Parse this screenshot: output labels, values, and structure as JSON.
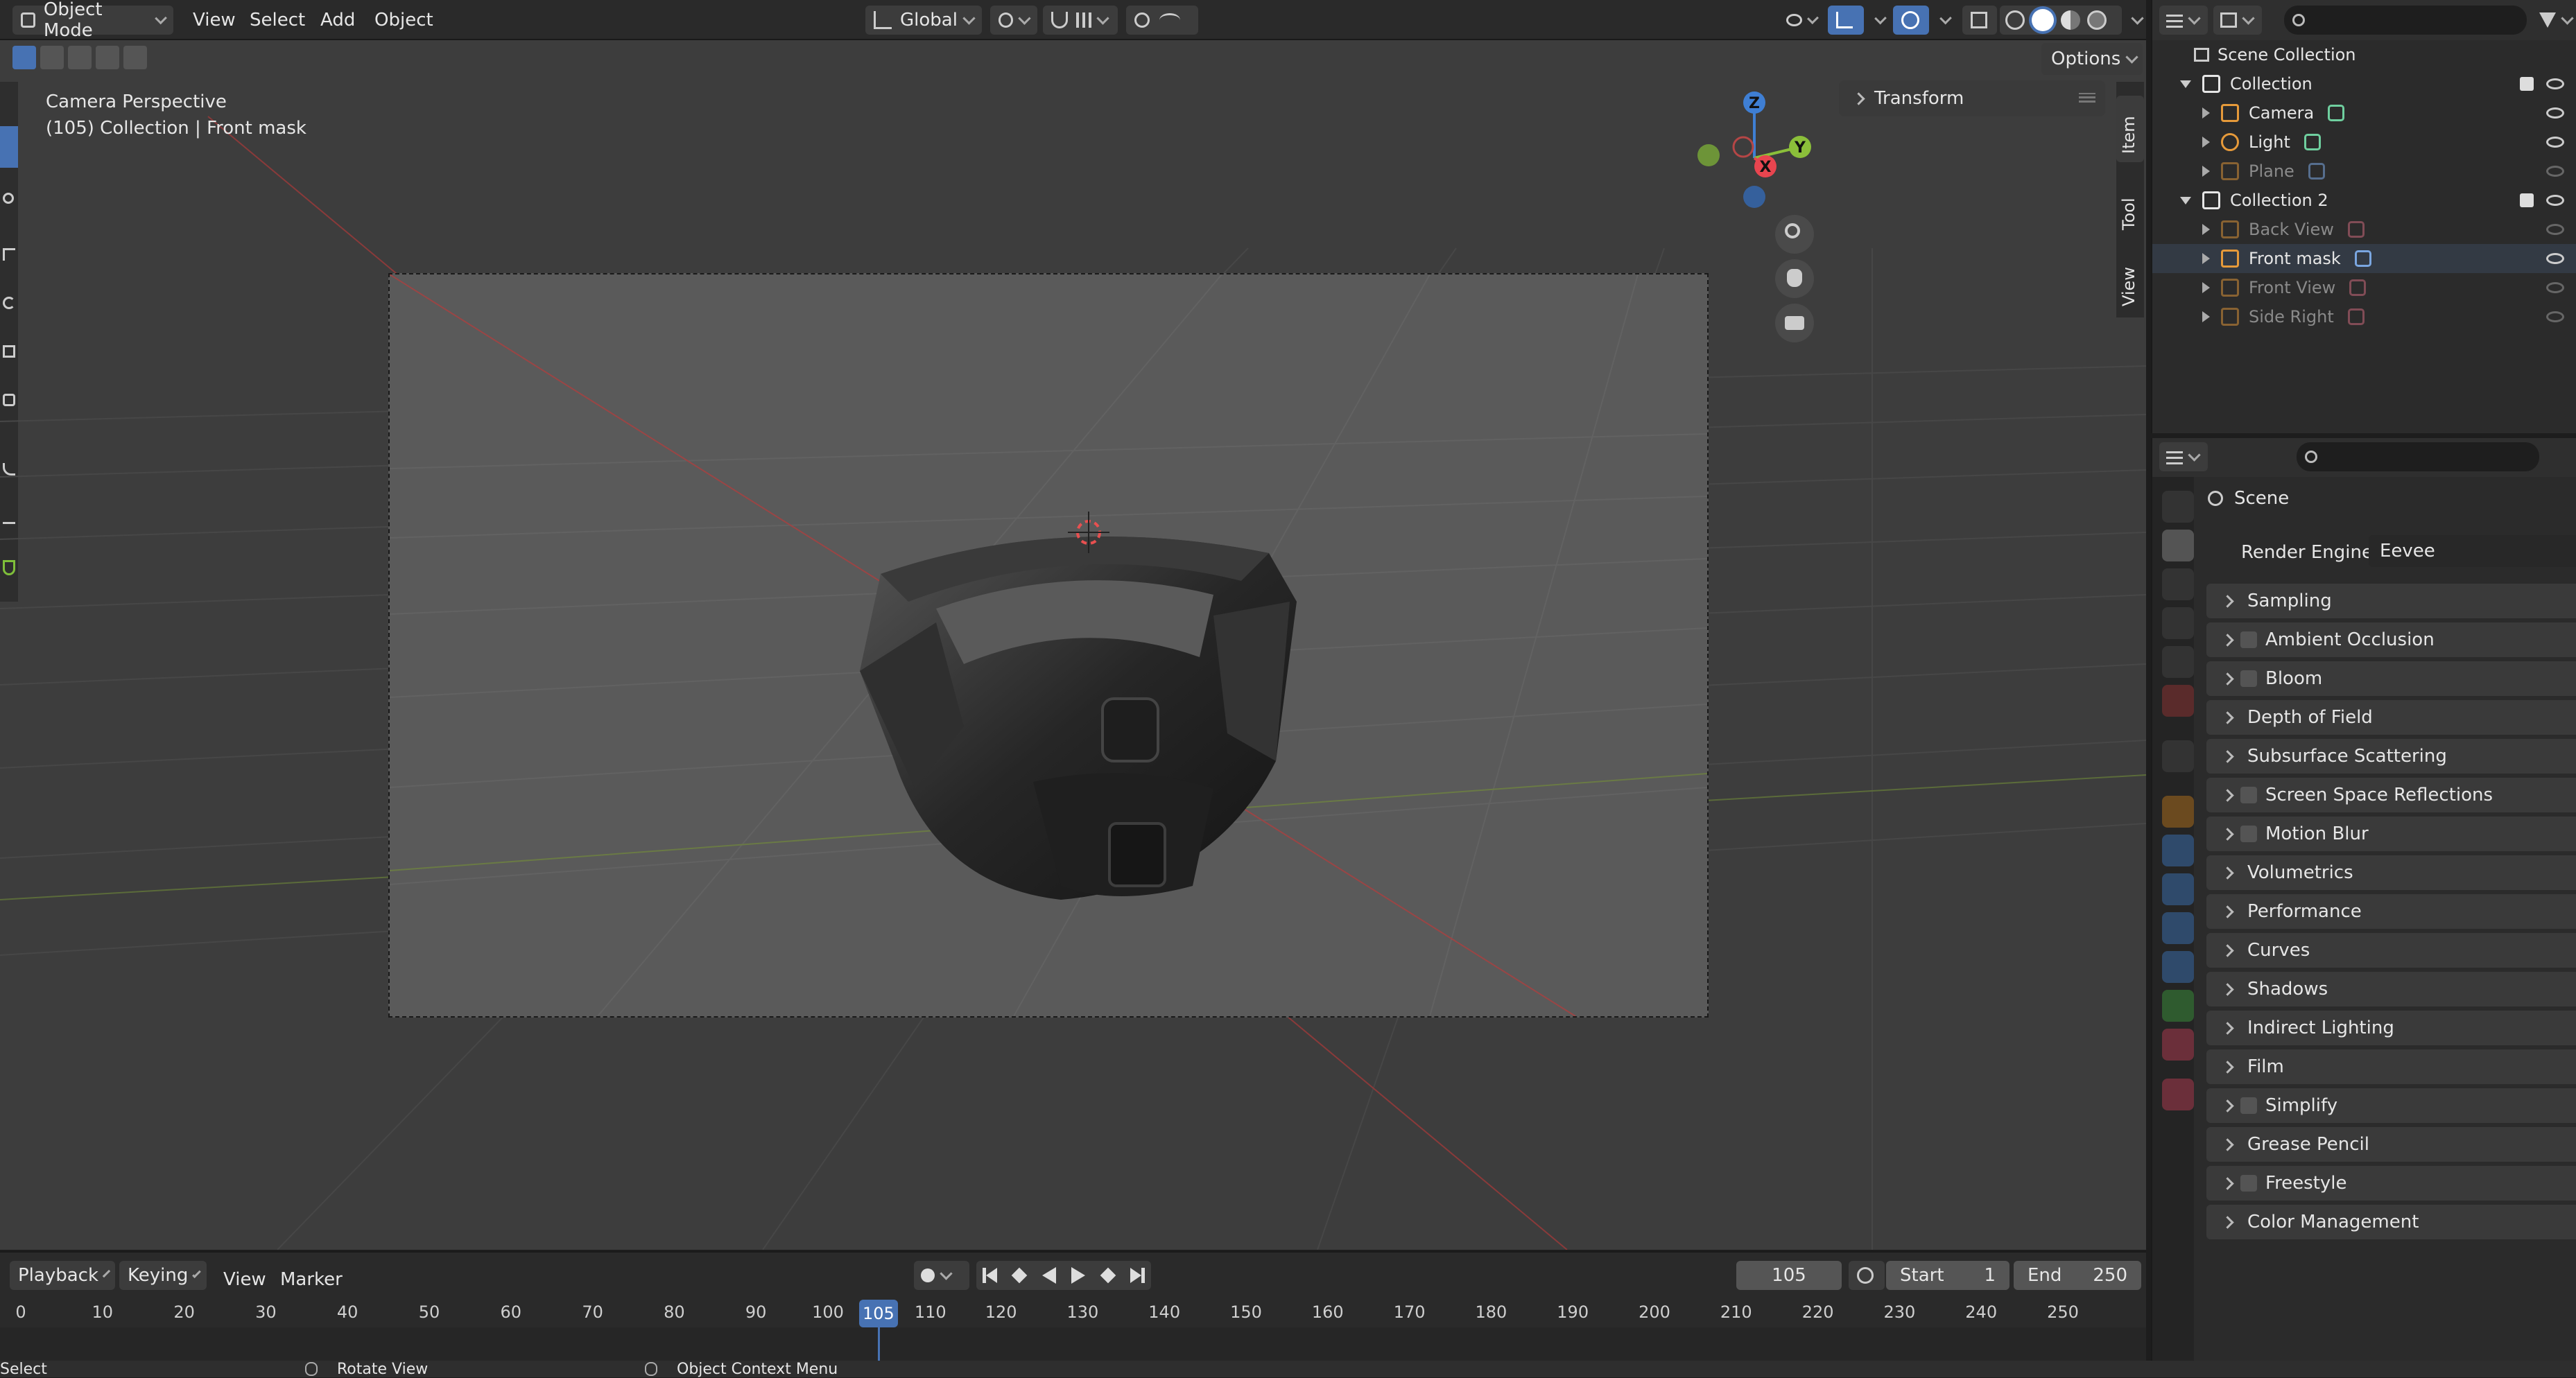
{
  "header": {
    "mode": "Object Mode",
    "menus": [
      "View",
      "Select",
      "Add",
      "Object"
    ],
    "transform_orientation": "Global"
  },
  "viewport": {
    "view_name": "Camera Perspective",
    "context": "(105) Collection | Front mask",
    "options_label": "Options",
    "transform_panel": "Transform",
    "side_tabs": [
      "Item",
      "Tool",
      "View"
    ],
    "gizmo": {
      "z": "Z",
      "y": "Y",
      "x": "X"
    }
  },
  "outliner": {
    "root": "Scene Collection",
    "rows": [
      {
        "label": "Collection",
        "type": "collection",
        "indent": 0,
        "dim": false
      },
      {
        "label": "Camera",
        "type": "camera",
        "indent": 1,
        "dim": false
      },
      {
        "label": "Light",
        "type": "light",
        "indent": 1,
        "dim": false
      },
      {
        "label": "Plane",
        "type": "mesh",
        "indent": 1,
        "dim": true
      },
      {
        "label": "Collection 2",
        "type": "collection",
        "indent": 0,
        "dim": false
      },
      {
        "label": "Back View",
        "type": "image",
        "indent": 1,
        "dim": true
      },
      {
        "label": "Front mask",
        "type": "mesh",
        "indent": 1,
        "dim": false
      },
      {
        "label": "Front View",
        "type": "image",
        "indent": 1,
        "dim": true
      },
      {
        "label": "Side Right",
        "type": "image",
        "indent": 1,
        "dim": true
      }
    ]
  },
  "properties": {
    "context_label": "Scene",
    "render_engine_label": "Render Engine",
    "render_engine_value": "Eevee",
    "panels": [
      {
        "label": "Sampling",
        "checkbox": false
      },
      {
        "label": "Ambient Occlusion",
        "checkbox": true
      },
      {
        "label": "Bloom",
        "checkbox": true
      },
      {
        "label": "Depth of Field",
        "checkbox": false
      },
      {
        "label": "Subsurface Scattering",
        "checkbox": false
      },
      {
        "label": "Screen Space Reflections",
        "checkbox": true
      },
      {
        "label": "Motion Blur",
        "checkbox": true
      },
      {
        "label": "Volumetrics",
        "checkbox": false
      },
      {
        "label": "Performance",
        "checkbox": false
      },
      {
        "label": "Curves",
        "checkbox": false
      },
      {
        "label": "Shadows",
        "checkbox": false
      },
      {
        "label": "Indirect Lighting",
        "checkbox": false
      },
      {
        "label": "Film",
        "checkbox": false
      },
      {
        "label": "Simplify",
        "checkbox": true
      },
      {
        "label": "Grease Pencil",
        "checkbox": false
      },
      {
        "label": "Freestyle",
        "checkbox": true
      },
      {
        "label": "Color Management",
        "checkbox": false
      }
    ]
  },
  "timeline": {
    "menus": [
      "Playback",
      "Keying",
      "View",
      "Marker"
    ],
    "current_frame": "105",
    "start_label": "Start",
    "start_value": "1",
    "end_label": "End",
    "end_value": "250",
    "ticks": [
      "0",
      "10",
      "20",
      "30",
      "40",
      "50",
      "60",
      "70",
      "80",
      "90",
      "100",
      "110",
      "120",
      "130",
      "140",
      "150",
      "160",
      "170",
      "180",
      "190",
      "200",
      "210",
      "220",
      "230",
      "240",
      "250"
    ]
  },
  "statusbar": {
    "items": [
      "Select",
      "Rotate View",
      "Object Context Menu"
    ]
  },
  "colors": {
    "accent": "#4772b3",
    "axis_x": "#e8454f",
    "axis_y": "#8bbf3a",
    "axis_z": "#3f7fd4"
  }
}
